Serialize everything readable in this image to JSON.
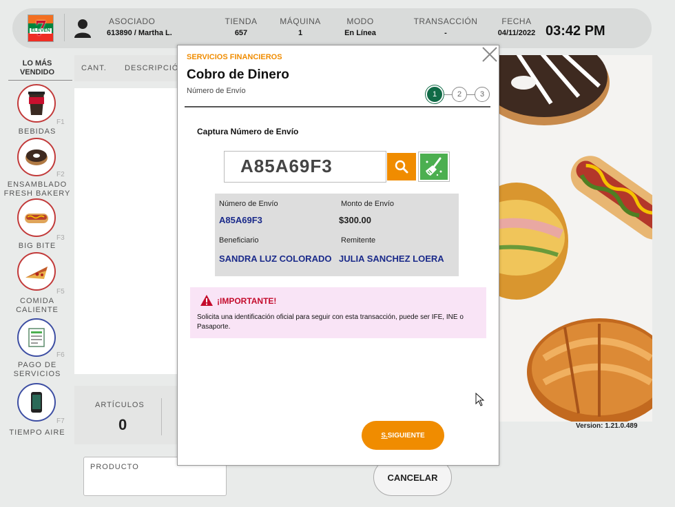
{
  "header": {
    "asociado_label": "ASOCIADO",
    "asociado_value": "613890 / Martha L.",
    "tienda_label": "TIENDA",
    "tienda_value": "657",
    "maquina_label": "MÁQUINA",
    "maquina_value": "1",
    "modo_label": "MODO",
    "modo_value": "En Línea",
    "transaccion_label": "TRANSACCIÓN",
    "transaccion_value": "-",
    "fecha_label": "FECHA",
    "fecha_value": "04/11/2022",
    "time": "03:42 PM",
    "logo_text": "7",
    "logo_sub": "ELEVEN"
  },
  "sidebar": {
    "title_line1": "LO MÁS",
    "title_line2": "VENDIDO",
    "items": [
      {
        "name1": "BEBIDAS",
        "name2": "",
        "key": "F1",
        "icon": "drink-cup-icon"
      },
      {
        "name1": "ENSAMBLADO",
        "name2": "FRESH BAKERY",
        "key": "F2",
        "icon": "donut-icon"
      },
      {
        "name1": "BIG BITE",
        "name2": "",
        "key": "F3",
        "icon": "hotdog-icon"
      },
      {
        "name1": "COMIDA",
        "name2": "CALIENTE",
        "key": "F5",
        "icon": "pizza-icon"
      },
      {
        "name1": "PAGO DE",
        "name2": "SERVICIOS",
        "key": "F6",
        "icon": "receipt-icon"
      },
      {
        "name1": "TIEMPO AIRE",
        "name2": "",
        "key": "F7",
        "icon": "phone-icon"
      }
    ]
  },
  "table": {
    "col_qty": "CANT.",
    "col_desc": "DESCRIPCIÓ"
  },
  "totals": {
    "articulos_label": "ARTÍCULOS",
    "articulos_value": "0"
  },
  "producto_label": "PRODUCTO",
  "cancel_label": "CANCELAR",
  "version": "Version: 1.21.0.489",
  "modal": {
    "section": "SERVICIOS FINANCIEROS",
    "title": "Cobro de Dinero",
    "subtitle": "Número de Envío",
    "steps": [
      "1",
      "2",
      "3"
    ],
    "capture_label": "Captura Número de Envío",
    "code_value": "A85A69F3",
    "info": {
      "numero_label": "Número de Envío",
      "numero_value": "A85A69F3",
      "monto_label": "Monto de Envío",
      "monto_value": "$300.00",
      "beneficiario_label": "Beneficiario",
      "beneficiario_value": "SANDRA LUZ COLORADO",
      "remitente_label": "Remitente",
      "remitente_value": "JULIA SANCHEZ LOERA"
    },
    "alert_title": "¡IMPORTANTE!",
    "alert_text": "Solicita una identificación oficial para seguir con esta transacción, puede ser IFE, INE o Pasaporte.",
    "next_key": "S.",
    "next_label": " SIGUIENTE"
  },
  "colors": {
    "accent_orange": "#f08c00",
    "step_green": "#116b47",
    "info_blue": "#1a2a8a",
    "alert_red": "#c40b2c"
  }
}
